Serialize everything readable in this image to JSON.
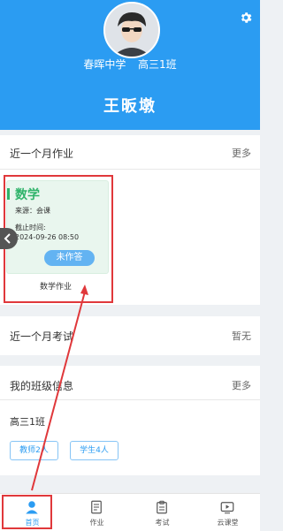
{
  "profile": {
    "school": "春晖中学",
    "class": "高三1班",
    "name": "王昄墩"
  },
  "homework_section": {
    "title": "近一个月作业",
    "more_label": "更多",
    "items": [
      {
        "subject": "数学",
        "source": "来源：会课",
        "deadline_label": "截止时间:",
        "deadline": "2024-09-26 08:50",
        "status": "未作答",
        "caption": "数学作业"
      }
    ]
  },
  "exam_section": {
    "title": "近一个月考试",
    "status_label": "暂无"
  },
  "class_section": {
    "title": "我的班级信息",
    "more_label": "更多",
    "class_name": "高三1班",
    "teachers_chip": "教师2人",
    "students_chip": "学生4人"
  },
  "tabbar": {
    "tabs": [
      {
        "label": "首页",
        "icon": "person-icon",
        "active": true
      },
      {
        "label": "作业",
        "icon": "document-icon"
      },
      {
        "label": "考试",
        "icon": "clipboard-icon"
      },
      {
        "label": "云课堂",
        "icon": "play-icon"
      }
    ]
  },
  "colors": {
    "header_blue": "#2b9cf2",
    "highlight_red": "#e0383b",
    "subject_green": "#2fb36a"
  }
}
